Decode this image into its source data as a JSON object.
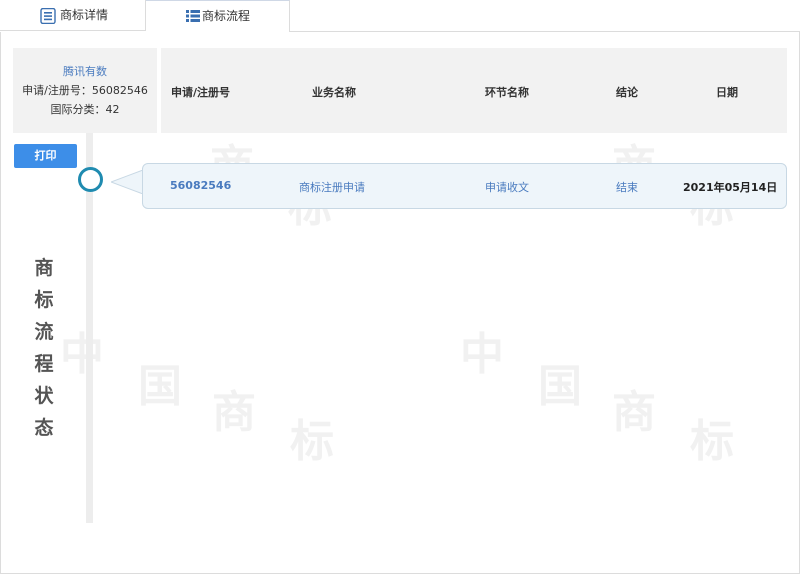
{
  "tabs": [
    {
      "label": "商标详情",
      "icon": "document-list-icon"
    },
    {
      "label": "商标流程",
      "icon": "list-icon"
    }
  ],
  "info": {
    "company": "腾讯有数",
    "app_no": "申请/注册号：56082546",
    "intl_class": "国际分类：42"
  },
  "print_label": "打印",
  "vertical_title": [
    "商",
    "标",
    "流",
    "程",
    "状",
    "态"
  ],
  "columns": {
    "reg_no": "申请/注册号",
    "business": "业务名称",
    "step": "环节名称",
    "conclusion": "结论",
    "date": "日期"
  },
  "records": [
    {
      "reg_no": "56082546",
      "business": "商标注册申请",
      "step": "申请收文",
      "conclusion": "结束",
      "date": "2021年05月14日"
    }
  ],
  "colors": {
    "accent": "#3d8ee8",
    "link": "#4a7bbf",
    "timeline_node": "#1f8bb0"
  }
}
